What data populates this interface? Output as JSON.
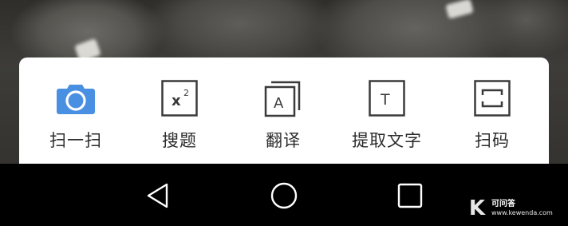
{
  "tools": [
    {
      "label": "扫一扫",
      "icon": "camera-icon"
    },
    {
      "label": "搜题",
      "icon": "x-squared-icon"
    },
    {
      "label": "翻译",
      "icon": "translate-a-icon"
    },
    {
      "label": "提取文字",
      "icon": "text-t-icon"
    },
    {
      "label": "扫码",
      "icon": "scan-code-icon"
    }
  ],
  "navbar": {
    "back": "back-triangle-icon",
    "home": "home-circle-icon",
    "recents": "recents-square-icon"
  },
  "watermark": {
    "logo": "K",
    "name": "可问答",
    "url": "www.kewenda.com"
  },
  "colors": {
    "accent": "#4a90e2",
    "icon_dark": "#3a3a3a",
    "panel": "#ffffff",
    "navbar": "#000000"
  }
}
